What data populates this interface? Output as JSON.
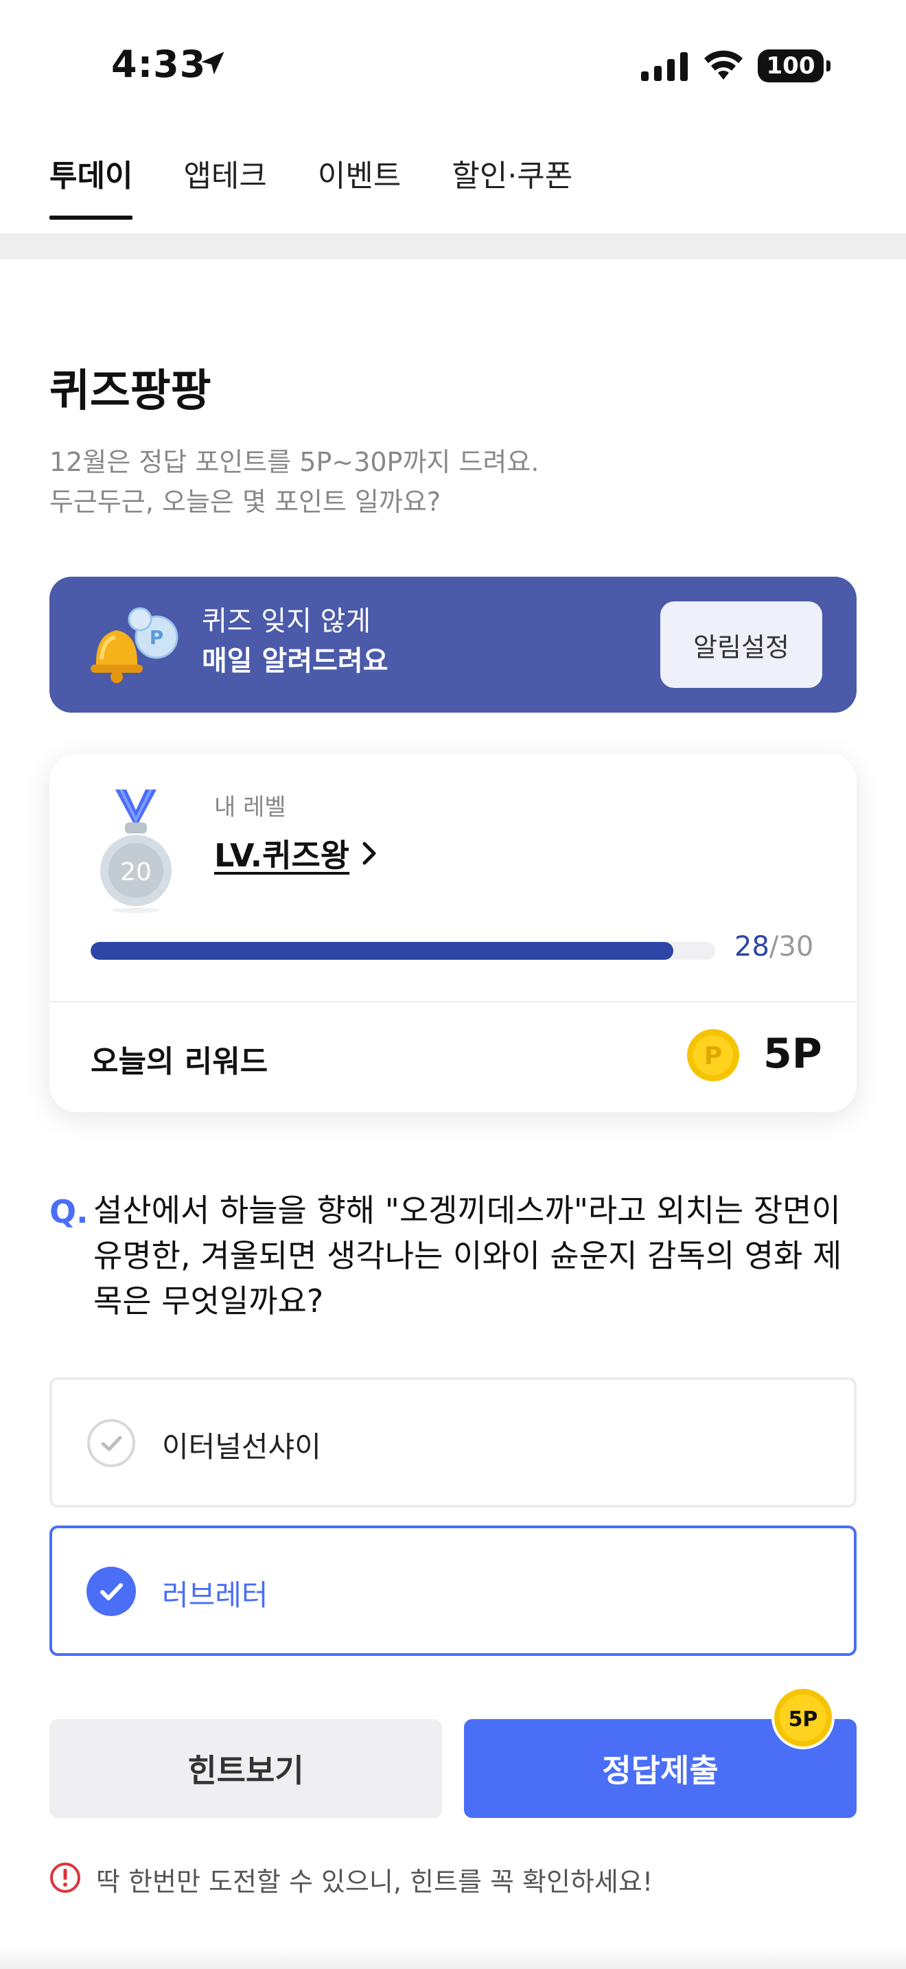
{
  "status_bar": {
    "time": "4:33",
    "battery": "100"
  },
  "tabs": [
    {
      "label": "투데이",
      "active": true
    },
    {
      "label": "앱테크",
      "active": false
    },
    {
      "label": "이벤트",
      "active": false
    },
    {
      "label": "할인·쿠폰",
      "active": false
    }
  ],
  "header": {
    "title": "퀴즈팡팡",
    "subtitle_line1": "12월은 정답 포인트를 5P~30P까지 드려요.",
    "subtitle_line2": "두근두근, 오늘은 몇 포인트 일까요?"
  },
  "banner": {
    "line1": "퀴즈 잊지 않게",
    "line2": "매일 알려드려요",
    "button_label": "알림설정",
    "icon": "bell-coin-icon"
  },
  "level_card": {
    "label": "내 레벨",
    "level_name": "LV.퀴즈왕",
    "medal_number": "20",
    "progress_current": "28",
    "progress_total": "/30",
    "progress_fraction": 0.933,
    "reward_label": "오늘의 리워드",
    "reward_value": "5P",
    "coin_letter": "P"
  },
  "question": {
    "prefix": "Q.",
    "text": "설산에서 하늘을 향해 \"오겡끼데스까\"라고 외치는 장면이 유명한, 겨울되면 생각나는 이와이 슌운지 감독의 영화 제목은 무엇일까요?"
  },
  "options": [
    {
      "label": "이터널선샤이",
      "selected": false
    },
    {
      "label": "러브레터",
      "selected": true
    }
  ],
  "actions": {
    "hint_label": "힌트보기",
    "submit_label": "정답제출",
    "badge": "5P"
  },
  "notice": "딱 한번만 도전할 수 있으니, 힌트를 꼭 확인하세요!",
  "colors": {
    "accent": "#4a6ef5",
    "banner": "#4b5aa9",
    "progress": "#2e46a5",
    "coin": "#f5c400"
  }
}
